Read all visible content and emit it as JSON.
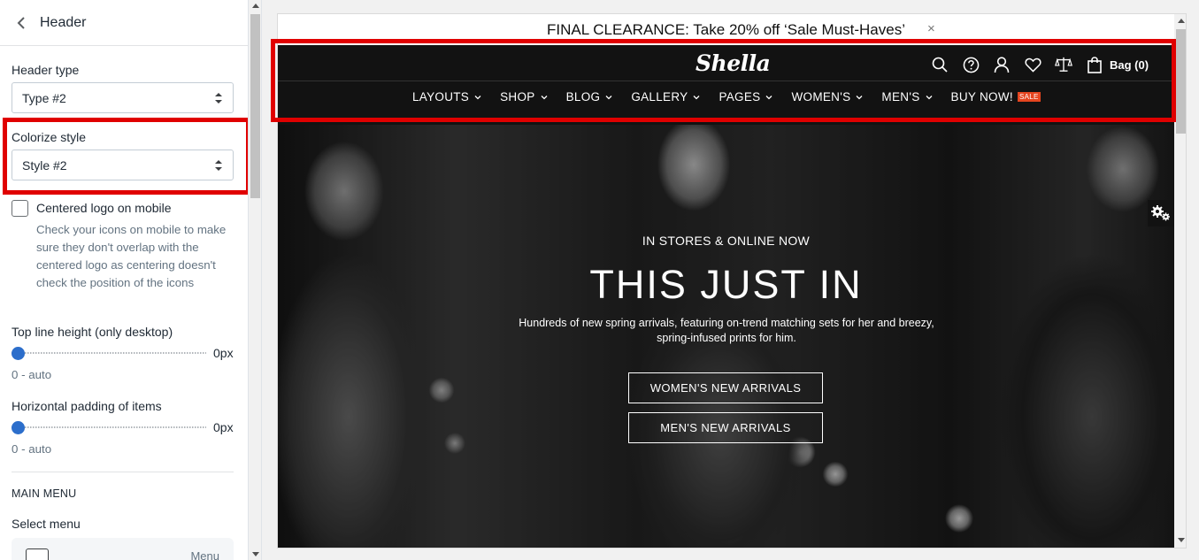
{
  "panel": {
    "title": "Header",
    "header_type": {
      "label": "Header type",
      "value": "Type #2"
    },
    "colorize_style": {
      "label": "Colorize style",
      "value": "Style #2"
    },
    "centered_logo": {
      "label": "Centered logo on mobile",
      "checked": false,
      "help": "Check your icons on mobile to make sure they don't overlap with the centered logo as centering doesn't check the position of the icons"
    },
    "top_line_height": {
      "label": "Top line height (only desktop)",
      "value": "0px",
      "range": "0 - auto"
    },
    "horizontal_padding": {
      "label": "Horizontal padding of items",
      "value": "0px",
      "range": "0 - auto"
    },
    "main_menu_heading": "MAIN MENU",
    "select_menu_label": "Select menu",
    "menu_card_text": "Menu"
  },
  "preview": {
    "announcement": "FINAL CLEARANCE: Take 20% off ‘Sale Must-Haves’",
    "announcement_close": "×",
    "logo": "Shella",
    "bag_label": "Bag (0)",
    "icons": [
      "search-icon",
      "help-icon",
      "account-icon",
      "wishlist-icon",
      "compare-icon",
      "bag-icon"
    ],
    "nav": [
      {
        "label": "LAYOUTS",
        "dropdown": true
      },
      {
        "label": "SHOP",
        "dropdown": true
      },
      {
        "label": "BLOG",
        "dropdown": true
      },
      {
        "label": "GALLERY",
        "dropdown": true
      },
      {
        "label": "PAGES",
        "dropdown": true
      },
      {
        "label": "WOMEN'S",
        "dropdown": true
      },
      {
        "label": "MEN'S",
        "dropdown": true
      },
      {
        "label": "BUY NOW!",
        "dropdown": false,
        "badge": "SALE"
      }
    ],
    "hero": {
      "eyebrow": "IN STORES & ONLINE NOW",
      "title": "THIS JUST IN",
      "description": "Hundreds of new spring arrivals, featuring on-trend matching sets for her and breezy, spring-infused prints for him.",
      "button_women": "WOMEN'S NEW ARRIVALS",
      "button_men": "MEN'S NEW ARRIVALS"
    }
  },
  "colors": {
    "highlight": "#e00000",
    "header_bg": "#121212",
    "slider_knob": "#2c6ecb",
    "sale_badge": "#e5451f"
  }
}
